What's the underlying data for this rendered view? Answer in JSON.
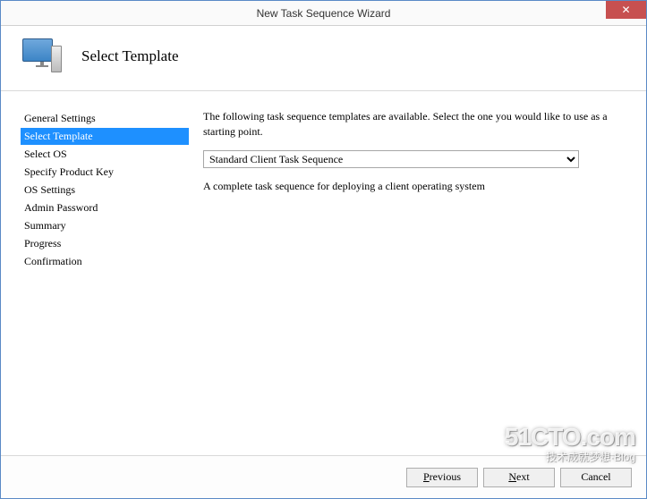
{
  "window": {
    "title": "New Task Sequence Wizard",
    "close_glyph": "✕"
  },
  "header": {
    "title": "Select Template"
  },
  "nav": {
    "items": [
      {
        "label": "General Settings",
        "selected": false
      },
      {
        "label": "Select Template",
        "selected": true
      },
      {
        "label": "Select OS",
        "selected": false
      },
      {
        "label": "Specify Product Key",
        "selected": false
      },
      {
        "label": "OS Settings",
        "selected": false
      },
      {
        "label": "Admin Password",
        "selected": false
      },
      {
        "label": "Summary",
        "selected": false
      },
      {
        "label": "Progress",
        "selected": false
      },
      {
        "label": "Confirmation",
        "selected": false
      }
    ]
  },
  "content": {
    "intro": "The following task sequence templates are available.  Select the one you would like to use as a starting point.",
    "dropdown": {
      "selected": "Standard Client Task Sequence"
    },
    "description": "A complete task sequence for deploying a client operating system"
  },
  "footer": {
    "previous": "Previous",
    "next": "Next",
    "cancel": "Cancel"
  },
  "watermark": {
    "main": "51CTO.com",
    "sub": "技术成就梦想·Blog"
  }
}
